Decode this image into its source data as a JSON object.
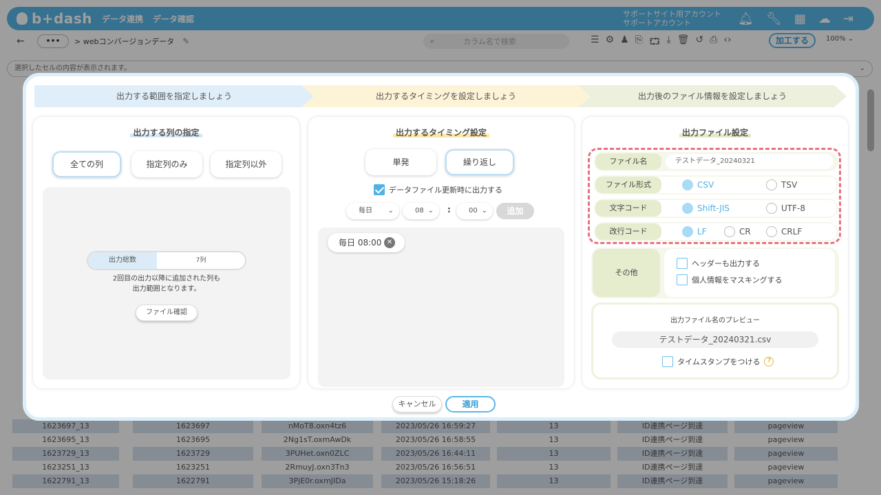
{
  "app": {
    "logo": "b+dash",
    "nav": [
      "データ連携",
      "データ確認"
    ],
    "account_line1": "サポートサイト用アカウント",
    "account_line2": "サポートアカウント",
    "breadcrumb": "> webコンバージョンデータ",
    "dots": "•••",
    "search_placeholder": "カラム名で検索",
    "process_button": "加工する",
    "zoom": "100%",
    "message": "選択したセルの内容が表示されます。",
    "rows": [
      [
        "1623697_13",
        "1623697",
        "nMoT8.oxn4tz6",
        "2023/05/26 16:59:27",
        "13",
        "ID連携ページ到達",
        "pageview"
      ],
      [
        "1623695_13",
        "1623695",
        "2Ng1sT.oxmAwDk",
        "2023/05/26 16:58:55",
        "13",
        "ID連携ページ到達",
        "pageview"
      ],
      [
        "1623729_13",
        "1623729",
        "3PUHet.oxn0ZLC",
        "2023/05/26 16:44:11",
        "13",
        "ID連携ページ到達",
        "pageview"
      ],
      [
        "1623251_13",
        "1623251",
        "2RmuyJ.oxn3Tn3",
        "2023/05/26 16:56:51",
        "13",
        "ID連携ページ到達",
        "pageview"
      ],
      [
        "1622791_13",
        "1622791",
        "3PjE0r.oxmJIDa",
        "2023/05/26 15:18:26",
        "13",
        "ID連携ページ到達",
        "pageview"
      ]
    ]
  },
  "steps": [
    "出力する範囲を指定しましょう",
    "出力するタイミングを設定しましょう",
    "出力後のファイル情報を設定しましょう"
  ],
  "columns_panel": {
    "title": "出力する列の指定",
    "options": [
      "全ての列",
      "指定列のみ",
      "指定列以外"
    ],
    "selected": 0,
    "total_label": "出力総数",
    "total_value": "7列",
    "note_line1": "2回目の出力以降に追加された列も",
    "note_line2": "出力範囲となります。",
    "file_check": "ファイル確認"
  },
  "timing_panel": {
    "title": "出力するタイミング設定",
    "options": [
      "単発",
      "繰り返し"
    ],
    "selected": 1,
    "update_checkbox": "データファイル更新時に出力する",
    "update_checked": true,
    "freq": "毎日",
    "hour": "08",
    "minute": "00",
    "colon": ":",
    "add": "追加",
    "schedule": "毎日 08:00"
  },
  "file_panel": {
    "title": "出力ファイル設定",
    "filename_label": "ファイル名",
    "filename_value": "テストデータ_20240321",
    "format_label": "ファイル形式",
    "format_options": [
      "CSV",
      "TSV"
    ],
    "encoding_label": "文字コード",
    "encoding_options": [
      "Shift-JIS",
      "UTF-8"
    ],
    "newline_label": "改行コード",
    "newline_options": [
      "LF",
      "CR",
      "CRLF"
    ],
    "other_label": "その他",
    "header_option": "ヘッダーも出力する",
    "mask_option": "個人情報をマスキングする",
    "preview_title": "出力ファイル名のプレビュー",
    "preview_value": "テストデータ_20240321.csv",
    "timestamp_option": "タイムスタンプをつける",
    "help": "?"
  },
  "footer": {
    "cancel": "キャンセル",
    "apply": "適用"
  },
  "colors": {
    "accent": "#58b7e8",
    "dashed": "#e9717e"
  }
}
